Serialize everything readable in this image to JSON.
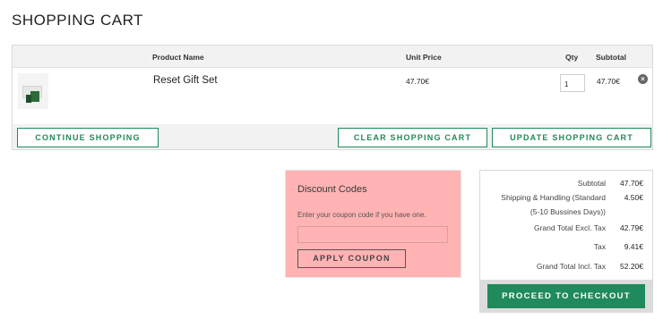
{
  "page": {
    "title": "SHOPPING CART"
  },
  "cart": {
    "headers": {
      "product": "Product Name",
      "unit_price": "Unit Price",
      "qty": "Qty",
      "subtotal": "Subtotal"
    },
    "items": [
      {
        "name": "Reset Gift Set",
        "unit_price": "47.70€",
        "qty": "1",
        "subtotal": "47.70€"
      }
    ],
    "actions": {
      "continue": "CONTINUE SHOPPING",
      "clear": "CLEAR SHOPPING CART",
      "update": "UPDATE SHOPPING CART"
    }
  },
  "discount": {
    "title": "Discount Codes",
    "hint": "Enter your coupon code if you have one.",
    "input_value": "",
    "apply_label": "APPLY COUPON"
  },
  "summary": {
    "subtotal_label": "Subtotal",
    "subtotal_value": "47.70€",
    "shipping_label_1": "Shipping & Handling (Standard",
    "shipping_label_2": "(5-10 Bussines Days))",
    "shipping_value": "4.50€",
    "grand_excl_label": "Grand Total Excl. Tax",
    "grand_excl_value": "42.79€",
    "tax_label": "Tax",
    "tax_value": "9.41€",
    "grand_incl_label": "Grand Total Incl. Tax",
    "grand_incl_value": "52.20€",
    "checkout_label": "PROCEED TO CHECKOUT"
  },
  "colors": {
    "accent": "#1f8a5b",
    "discount_bg": "#ffb3b3",
    "table_bg": "#f2f2f2"
  },
  "icons": {
    "remove": "remove-item-icon"
  }
}
